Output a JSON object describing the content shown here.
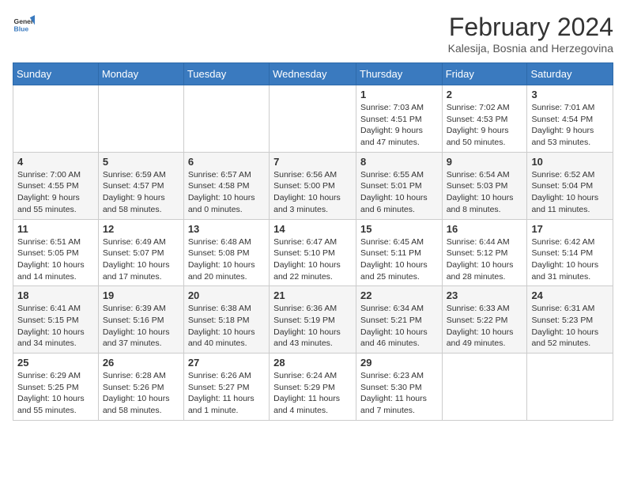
{
  "logo": {
    "general": "General",
    "blue": "Blue"
  },
  "title": "February 2024",
  "subtitle": "Kalesija, Bosnia and Herzegovina",
  "days_of_week": [
    "Sunday",
    "Monday",
    "Tuesday",
    "Wednesday",
    "Thursday",
    "Friday",
    "Saturday"
  ],
  "weeks": [
    [
      {
        "day": "",
        "info": ""
      },
      {
        "day": "",
        "info": ""
      },
      {
        "day": "",
        "info": ""
      },
      {
        "day": "",
        "info": ""
      },
      {
        "day": "1",
        "info": "Sunrise: 7:03 AM\nSunset: 4:51 PM\nDaylight: 9 hours and 47 minutes."
      },
      {
        "day": "2",
        "info": "Sunrise: 7:02 AM\nSunset: 4:53 PM\nDaylight: 9 hours and 50 minutes."
      },
      {
        "day": "3",
        "info": "Sunrise: 7:01 AM\nSunset: 4:54 PM\nDaylight: 9 hours and 53 minutes."
      }
    ],
    [
      {
        "day": "4",
        "info": "Sunrise: 7:00 AM\nSunset: 4:55 PM\nDaylight: 9 hours and 55 minutes."
      },
      {
        "day": "5",
        "info": "Sunrise: 6:59 AM\nSunset: 4:57 PM\nDaylight: 9 hours and 58 minutes."
      },
      {
        "day": "6",
        "info": "Sunrise: 6:57 AM\nSunset: 4:58 PM\nDaylight: 10 hours and 0 minutes."
      },
      {
        "day": "7",
        "info": "Sunrise: 6:56 AM\nSunset: 5:00 PM\nDaylight: 10 hours and 3 minutes."
      },
      {
        "day": "8",
        "info": "Sunrise: 6:55 AM\nSunset: 5:01 PM\nDaylight: 10 hours and 6 minutes."
      },
      {
        "day": "9",
        "info": "Sunrise: 6:54 AM\nSunset: 5:03 PM\nDaylight: 10 hours and 8 minutes."
      },
      {
        "day": "10",
        "info": "Sunrise: 6:52 AM\nSunset: 5:04 PM\nDaylight: 10 hours and 11 minutes."
      }
    ],
    [
      {
        "day": "11",
        "info": "Sunrise: 6:51 AM\nSunset: 5:05 PM\nDaylight: 10 hours and 14 minutes."
      },
      {
        "day": "12",
        "info": "Sunrise: 6:49 AM\nSunset: 5:07 PM\nDaylight: 10 hours and 17 minutes."
      },
      {
        "day": "13",
        "info": "Sunrise: 6:48 AM\nSunset: 5:08 PM\nDaylight: 10 hours and 20 minutes."
      },
      {
        "day": "14",
        "info": "Sunrise: 6:47 AM\nSunset: 5:10 PM\nDaylight: 10 hours and 22 minutes."
      },
      {
        "day": "15",
        "info": "Sunrise: 6:45 AM\nSunset: 5:11 PM\nDaylight: 10 hours and 25 minutes."
      },
      {
        "day": "16",
        "info": "Sunrise: 6:44 AM\nSunset: 5:12 PM\nDaylight: 10 hours and 28 minutes."
      },
      {
        "day": "17",
        "info": "Sunrise: 6:42 AM\nSunset: 5:14 PM\nDaylight: 10 hours and 31 minutes."
      }
    ],
    [
      {
        "day": "18",
        "info": "Sunrise: 6:41 AM\nSunset: 5:15 PM\nDaylight: 10 hours and 34 minutes."
      },
      {
        "day": "19",
        "info": "Sunrise: 6:39 AM\nSunset: 5:16 PM\nDaylight: 10 hours and 37 minutes."
      },
      {
        "day": "20",
        "info": "Sunrise: 6:38 AM\nSunset: 5:18 PM\nDaylight: 10 hours and 40 minutes."
      },
      {
        "day": "21",
        "info": "Sunrise: 6:36 AM\nSunset: 5:19 PM\nDaylight: 10 hours and 43 minutes."
      },
      {
        "day": "22",
        "info": "Sunrise: 6:34 AM\nSunset: 5:21 PM\nDaylight: 10 hours and 46 minutes."
      },
      {
        "day": "23",
        "info": "Sunrise: 6:33 AM\nSunset: 5:22 PM\nDaylight: 10 hours and 49 minutes."
      },
      {
        "day": "24",
        "info": "Sunrise: 6:31 AM\nSunset: 5:23 PM\nDaylight: 10 hours and 52 minutes."
      }
    ],
    [
      {
        "day": "25",
        "info": "Sunrise: 6:29 AM\nSunset: 5:25 PM\nDaylight: 10 hours and 55 minutes."
      },
      {
        "day": "26",
        "info": "Sunrise: 6:28 AM\nSunset: 5:26 PM\nDaylight: 10 hours and 58 minutes."
      },
      {
        "day": "27",
        "info": "Sunrise: 6:26 AM\nSunset: 5:27 PM\nDaylight: 11 hours and 1 minute."
      },
      {
        "day": "28",
        "info": "Sunrise: 6:24 AM\nSunset: 5:29 PM\nDaylight: 11 hours and 4 minutes."
      },
      {
        "day": "29",
        "info": "Sunrise: 6:23 AM\nSunset: 5:30 PM\nDaylight: 11 hours and 7 minutes."
      },
      {
        "day": "",
        "info": ""
      },
      {
        "day": "",
        "info": ""
      }
    ]
  ]
}
